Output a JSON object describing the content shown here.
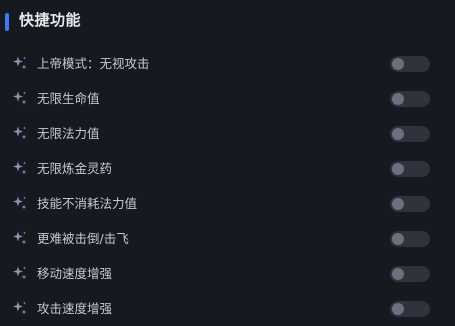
{
  "section": {
    "title": "快捷功能",
    "accent_color": "#3d7bf0"
  },
  "items": [
    {
      "label": "上帝模式：无视攻击",
      "icon": "sparkle-icon",
      "enabled": false
    },
    {
      "label": "无限生命值",
      "icon": "sparkle-icon",
      "enabled": false
    },
    {
      "label": "无限法力值",
      "icon": "sparkle-icon",
      "enabled": false
    },
    {
      "label": "无限炼金灵药",
      "icon": "sparkle-icon",
      "enabled": false
    },
    {
      "label": "技能不消耗法力值",
      "icon": "sparkle-icon",
      "enabled": false
    },
    {
      "label": "更难被击倒/击飞",
      "icon": "sparkle-icon",
      "enabled": false
    },
    {
      "label": "移动速度增强",
      "icon": "sparkle-icon",
      "enabled": false
    },
    {
      "label": "攻击速度增强",
      "icon": "sparkle-icon",
      "enabled": false
    }
  ]
}
